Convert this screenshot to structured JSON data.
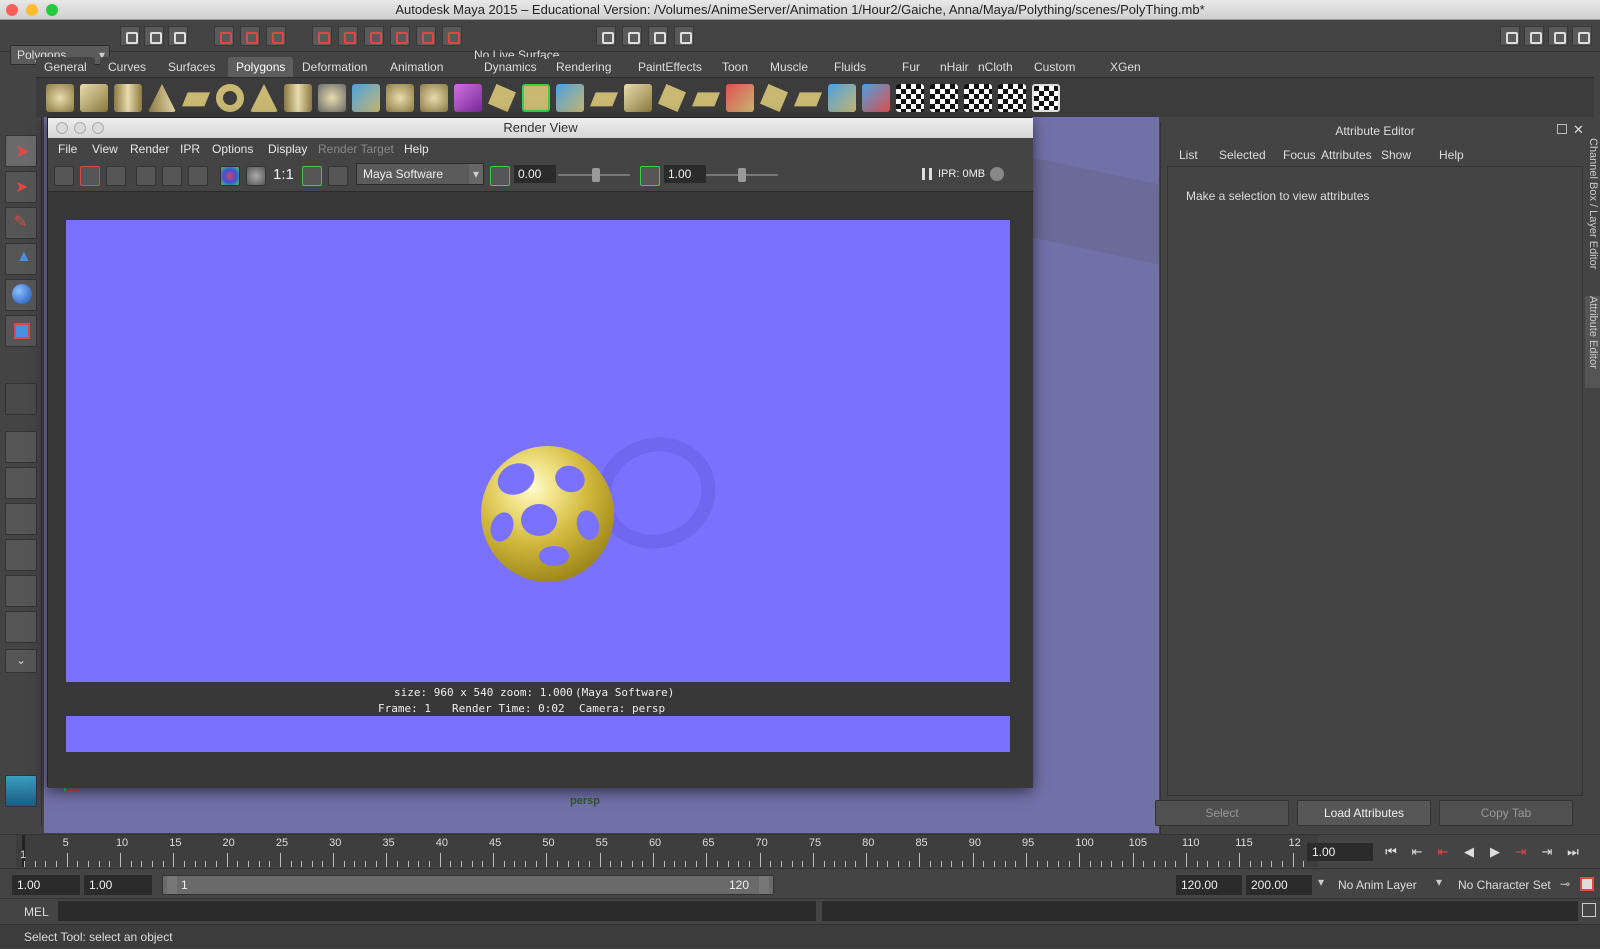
{
  "app": {
    "title": "Autodesk Maya 2015 – Educational Version: /Volumes/AnimeServer/Animation 1/Hour2/Gaiche, Anna/Maya/Polything/scenes/PolyThing.mb*"
  },
  "status_line": {
    "menu_set": "Polygons",
    "live_surface": "No Live Surface"
  },
  "shelf": {
    "tabs": [
      "General",
      "Curves",
      "Surfaces",
      "Polygons",
      "Deformation",
      "Animation",
      "Dynamics",
      "Rendering",
      "PaintEffects",
      "Toon",
      "Muscle",
      "Fluids",
      "Fur",
      "nHair",
      "nCloth",
      "Custom",
      "XGen"
    ],
    "active": "Polygons"
  },
  "viewport": {
    "camera_label": "persp"
  },
  "render_view": {
    "title": "Render View",
    "menu": [
      "File",
      "View",
      "Render",
      "IPR",
      "Options",
      "Display",
      "Render Target",
      "Help"
    ],
    "zoom_label": "1:1",
    "renderer": "Maya Software",
    "exposure": "0.00",
    "gamma": "1.00",
    "ipr": "IPR: 0MB",
    "status_line1_size": "size:  960 x 540  zoom: 1.000",
    "status_line1_renderer": "(Maya Software)",
    "status_line2_frame": "Frame: 1",
    "status_line2_time": "Render Time: 0:02",
    "status_line2_camera": "Camera: persp",
    "colors": {
      "background": "#7a72fe",
      "object": "#d1b83c"
    }
  },
  "attribute_editor": {
    "title": "Attribute Editor",
    "menu": [
      "List",
      "Selected",
      "Focus",
      "Attributes",
      "Show",
      "Help"
    ],
    "message": "Make a selection to view attributes",
    "buttons": [
      "Select",
      "Load Attributes",
      "Copy Tab"
    ]
  },
  "side_tabs": [
    "Channel Box / Layer Editor",
    "Attribute Editor"
  ],
  "time_slider": {
    "labels": [
      "5",
      "10",
      "15",
      "20",
      "25",
      "30",
      "35",
      "40",
      "45",
      "50",
      "55",
      "60",
      "65",
      "70",
      "75",
      "80",
      "85",
      "90",
      "95",
      "100",
      "105",
      "110",
      "115",
      "12"
    ],
    "current_marker": "1",
    "current_frame": "1.00"
  },
  "range_slider": {
    "start": "1.00",
    "playback_start": "1.00",
    "range_left": "1",
    "range_right": "120",
    "playback_end": "120.00",
    "end": "200.00",
    "anim_layer": "No Anim Layer",
    "character_set": "No Character Set"
  },
  "command_line": {
    "label": "MEL"
  },
  "help_line": {
    "text": "Select Tool: select an object"
  }
}
